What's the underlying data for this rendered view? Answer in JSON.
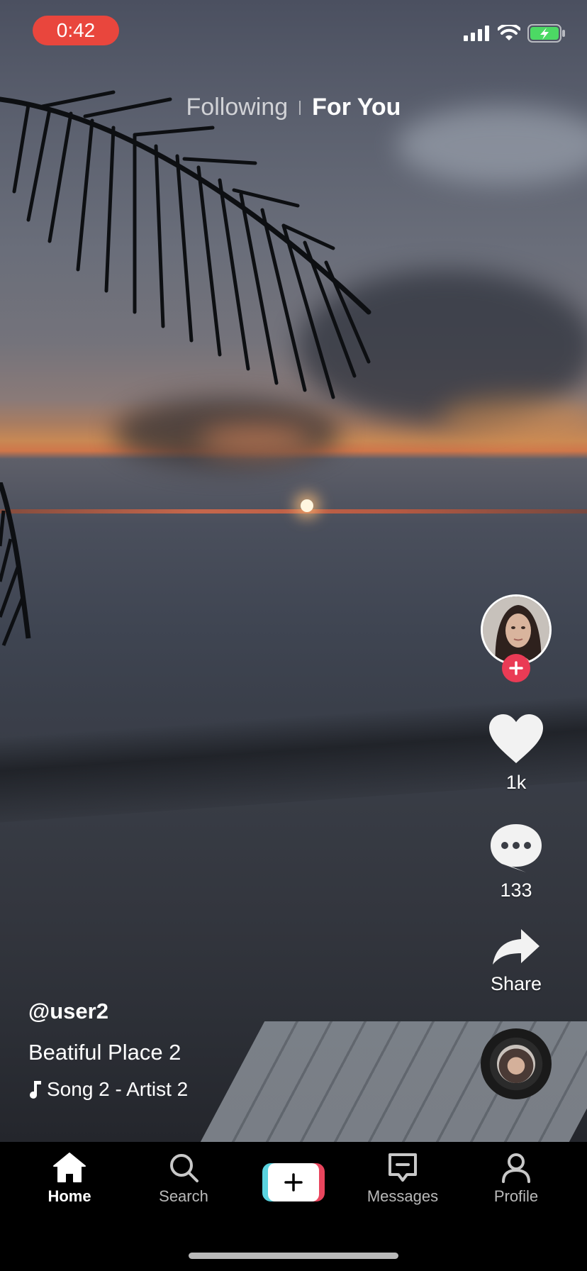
{
  "status_bar": {
    "time": "0:42",
    "icons": [
      "cellular-signal-icon",
      "wifi-icon",
      "battery-charging-icon"
    ],
    "colors": {
      "time_pill": "#e9463d",
      "battery": "#4cd964"
    }
  },
  "top_tabs": {
    "following_label": "Following",
    "for_you_label": "For You",
    "active": "For You"
  },
  "actions": {
    "likes": "1k",
    "comments": "133",
    "share_label": "Share",
    "icons": [
      "heart-icon",
      "comment-bubble-icon",
      "share-arrow-icon",
      "plus-icon"
    ]
  },
  "video": {
    "username": "@user2",
    "description": "Beatiful Place 2",
    "song": "Song 2 - Artist 2"
  },
  "bottom_nav": {
    "items": [
      {
        "label": "Home",
        "icon": "home-icon",
        "active": true
      },
      {
        "label": "Search",
        "icon": "search-icon",
        "active": false
      },
      {
        "label": "",
        "icon": "create-plus-icon",
        "active": false
      },
      {
        "label": "Messages",
        "icon": "message-icon",
        "active": false
      },
      {
        "label": "Profile",
        "icon": "profile-icon",
        "active": false
      }
    ]
  },
  "colors": {
    "accent_red": "#ea3b55",
    "accent_cyan": "#5ad3df",
    "nav_background": "#000000"
  }
}
